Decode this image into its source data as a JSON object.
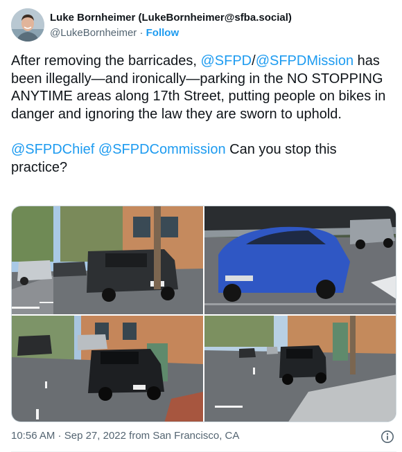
{
  "author": {
    "display_name": "Luke Bornheimer (LukeBornheimer@sfba.social)",
    "handle": "@LukeBornheimer",
    "separator": "·",
    "follow_label": "Follow"
  },
  "tweet": {
    "p1_a": "After removing the barricades, ",
    "mention_sfpd": "@SFPD",
    "slash": "/",
    "mention_sfpdmission": "@SFPDMission",
    "p1_b": " has been illegally—and ironically—parking in the NO STOPPING ANYTIME areas along 17th Street, putting people on bikes in danger and ignoring the law they are sworn to uphold.",
    "mention_chief": "@SFPDChief",
    "space": " ",
    "mention_commission": "@SFPDCommission",
    "p2": " Can you stop this practice?"
  },
  "footer": {
    "time": "10:56 AM",
    "dot": " · ",
    "date": "Sep 27, 2022",
    "source": " from San Francisco, CA"
  },
  "icons": {
    "info": "info-icon"
  },
  "colors": {
    "accent": "#1d9bf0",
    "secondary_text": "#536471",
    "text": "#0f1419",
    "border": "#cfd9de"
  }
}
